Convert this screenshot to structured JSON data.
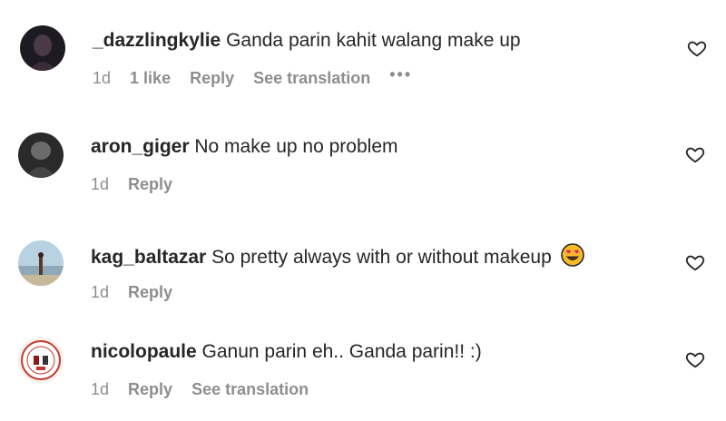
{
  "comments": [
    {
      "username": "_dazzlingkylie",
      "text": "Ganda parin kahit walang make up",
      "time": "1d",
      "likes": "1 like",
      "reply": "Reply",
      "translation": "See translation",
      "more": "•••"
    },
    {
      "username": "aron_giger",
      "text": "No make up no problem",
      "time": "1d",
      "reply": "Reply"
    },
    {
      "username": "kag_baltazar",
      "text": "So pretty always with or without makeup",
      "emoji": "heart-eyes-emoji",
      "time": "1d",
      "reply": "Reply"
    },
    {
      "username": "nicolopaule",
      "text": "Ganun parin eh.. Ganda parin!! :)",
      "time": "1d",
      "reply": "Reply",
      "translation": "See translation"
    }
  ],
  "colors": {
    "text": "#262626",
    "meta": "#8e8e8e",
    "heart_outline": "#262626"
  }
}
